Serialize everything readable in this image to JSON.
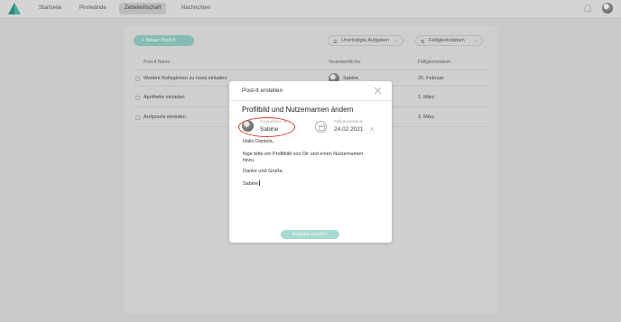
{
  "nav": {
    "items": [
      "Startseite",
      "Pinnwände",
      "Zettelwirtschaft",
      "Nachrichten"
    ]
  },
  "colors": {
    "accent": "#86bcb4",
    "highlight": "#d93b2b",
    "submit": "#a6d9d1"
  },
  "toolbar": {
    "new_button": "+ Neuer Post-It",
    "filter_status": "Unerledigte Aufgaben",
    "filter_sort": "Fälligkeitsdatum"
  },
  "table": {
    "headers": [
      "Post-It Name",
      "Verantwortlicher",
      "Fälligkeitsdatum"
    ],
    "rows": [
      {
        "name": "Weitere Kolleginnen zu nooa einladen",
        "person": "Sabine",
        "date": "26. Februar"
      },
      {
        "name": "Apotheke einladen",
        "person": "",
        "date": "1. März"
      },
      {
        "name": "Arztpraxis einladen",
        "person": "",
        "date": "3. März"
      }
    ]
  },
  "modal": {
    "title": "Post-It erstellen",
    "subject": "Profilbild und Nutzernamen ändern",
    "assigned_label": "Zugewiesen an",
    "assigned_value": "Sabine",
    "due_label": "Fälligkeitsdatum",
    "due_value": "24.02.2021",
    "body": {
      "greeting": "Hallo Daniela,",
      "line1": "füge bitte ein Profilbild von Dir und einen Nutzernamen",
      "line2": "hinzu.",
      "thanks": "Danke und Grüße,",
      "signature": "Sabine"
    },
    "submit": "Aufgabe erstellen"
  },
  "icons": [
    "logo-icon",
    "bell-icon",
    "close-icon",
    "calendar-icon",
    "clear-icon",
    "filter-icon",
    "sort-icon",
    "chevron-down-icon"
  ]
}
